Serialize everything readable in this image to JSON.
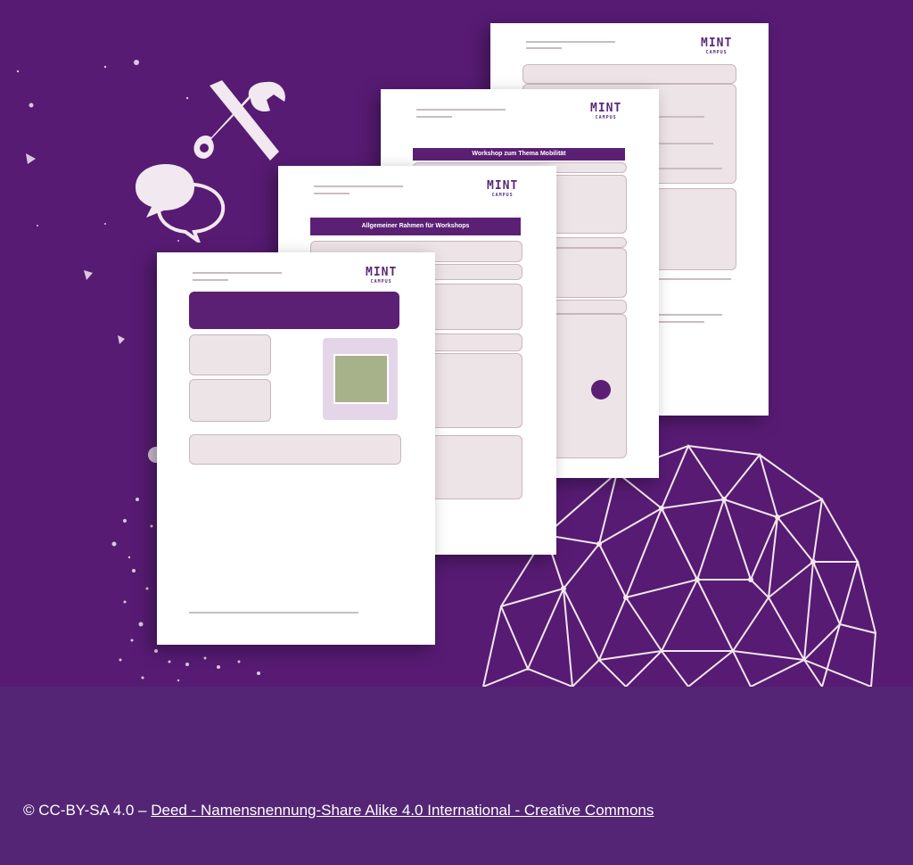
{
  "credit": {
    "prefix": "© CC-BY-SA 4.0 – ",
    "link_text": "Deed - Namensnennung-Share Alike 4.0 International - Creative Commons"
  },
  "pages": {
    "brand": "MINT",
    "brand_sub": "CAMPUS",
    "page2_banner": "Allgemeiner Rahmen für Workshops",
    "page3_banner": "Workshop zum Thema Mobilität"
  },
  "colors": {
    "background": "#571b73",
    "footer": "#532574",
    "banner": "#5b1f74",
    "box": "#ede4e7"
  },
  "icons": [
    "wrench-screwdriver-icon",
    "speech-bubbles-icon",
    "geodesic-sphere-icon"
  ]
}
